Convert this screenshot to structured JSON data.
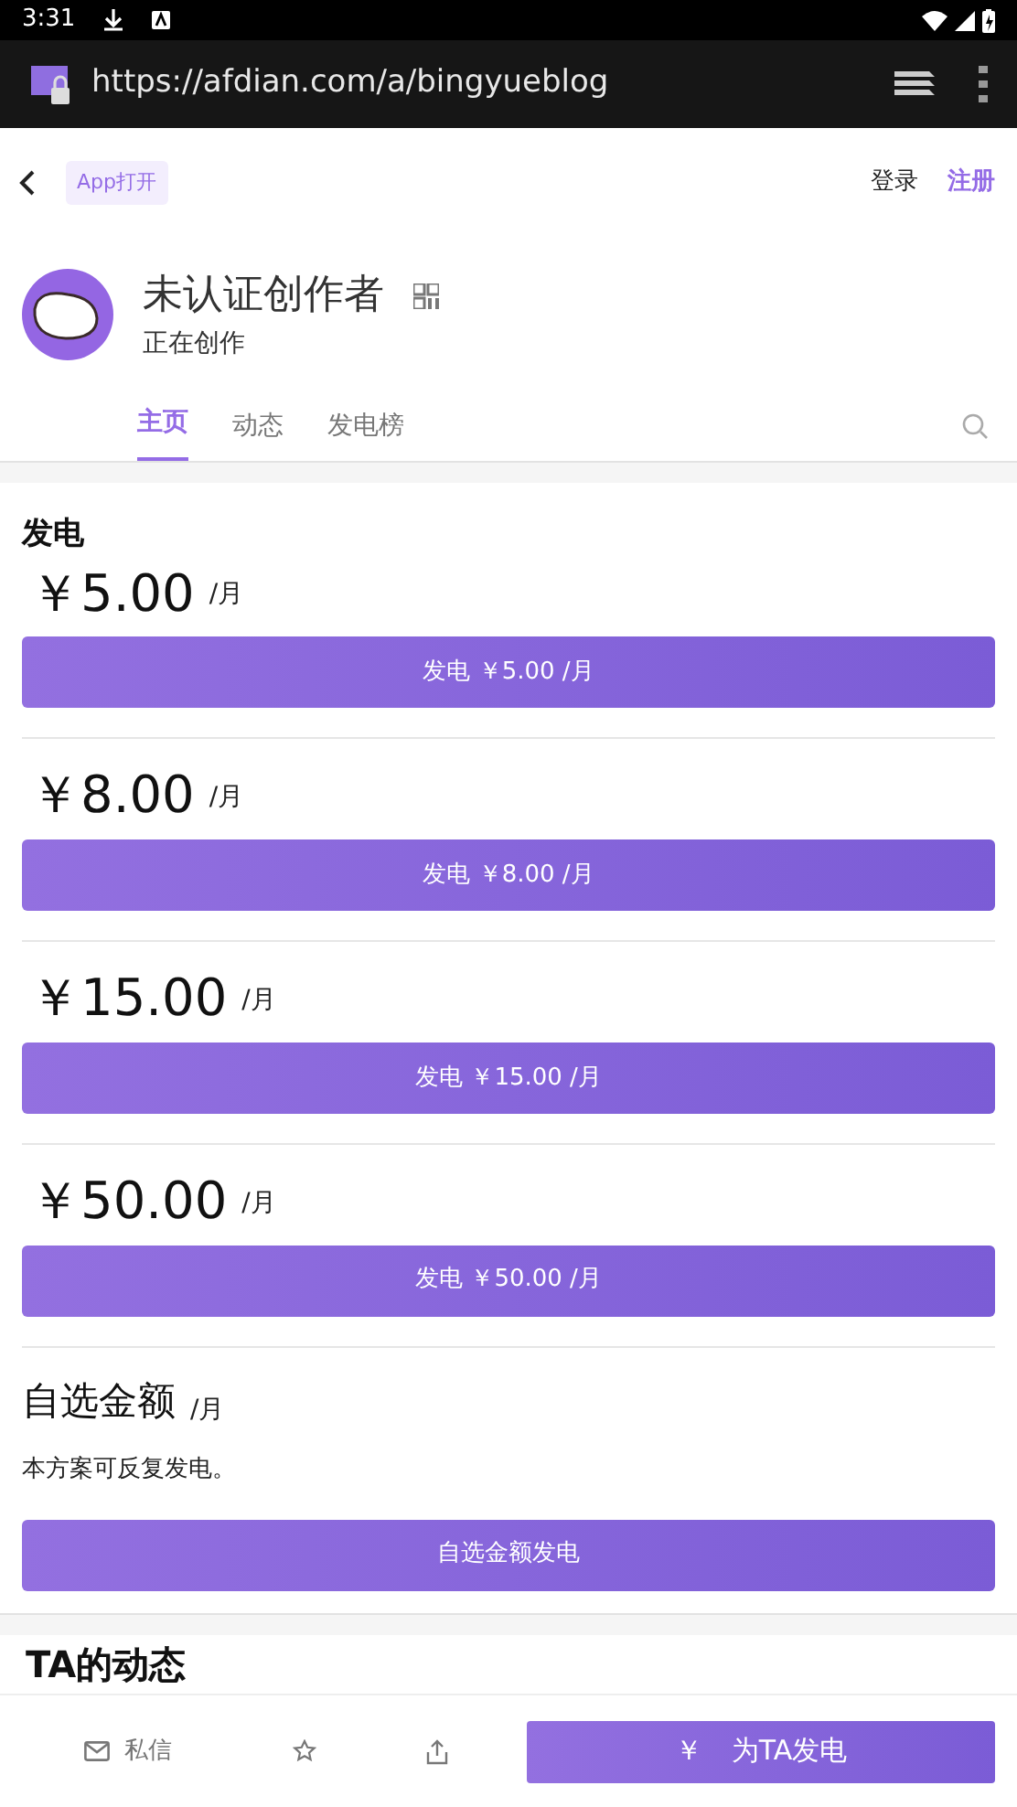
{
  "status_bar": {
    "time": "3:31"
  },
  "browser": {
    "url": "https://afdian.com/a/bingyueblog"
  },
  "header": {
    "app_open": "App打开",
    "login": "登录",
    "register": "注册"
  },
  "profile": {
    "name": "未认证创作者",
    "subtitle": "正在创作"
  },
  "tabs": [
    {
      "label": "主页",
      "selected": true
    },
    {
      "label": "动态",
      "selected": false
    },
    {
      "label": "发电榜",
      "selected": false
    }
  ],
  "support": {
    "title": "发电",
    "tiers": [
      {
        "price": "￥5.00",
        "period": "/月",
        "button": "发电 ￥5.00 /月"
      },
      {
        "price": "￥8.00",
        "period": "/月",
        "button": "发电 ￥8.00 /月"
      },
      {
        "price": "￥15.00",
        "period": "/月",
        "button": "发电 ￥15.00 /月"
      },
      {
        "price": "￥50.00",
        "period": "/月",
        "button": "发电 ￥50.00 /月"
      }
    ],
    "custom": {
      "title": "自选金额",
      "period": "/月",
      "note": "本方案可反复发电。",
      "button": "自选金额发电"
    }
  },
  "feed_title": "TA的动态",
  "bottom_bar": {
    "message": "私信",
    "support_symbol": "￥",
    "support_label": "为TA发电"
  }
}
